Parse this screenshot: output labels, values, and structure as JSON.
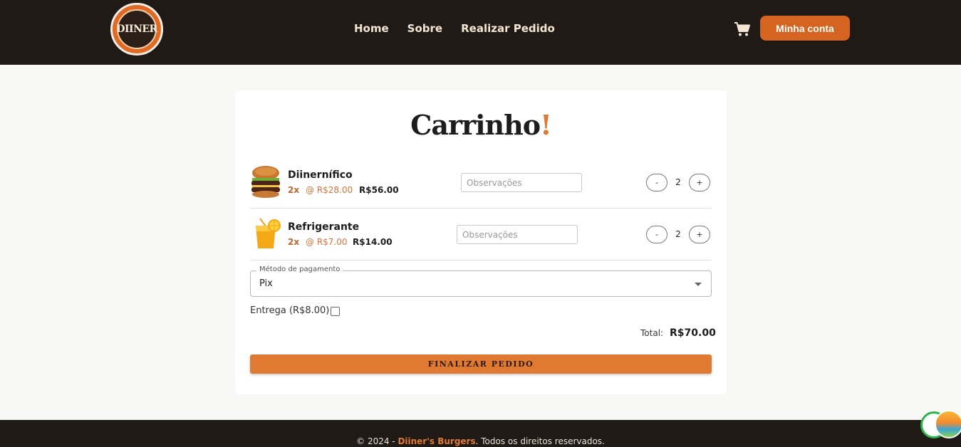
{
  "header": {
    "logo_text": "DIINER",
    "nav": [
      "Home",
      "Sobre",
      "Realizar Pedido"
    ],
    "account_button": "Minha conta"
  },
  "cart": {
    "title": "Carrinho",
    "title_accent": "!",
    "items": [
      {
        "name": "Diinernífico",
        "qty_label": "2x",
        "unit_price": "@ R$28.00",
        "line_total": "R$56.00",
        "obs_placeholder": "Observações",
        "minus": "-",
        "qty": "2",
        "plus": "+"
      },
      {
        "name": "Refrigerante",
        "qty_label": "2x",
        "unit_price": "@ R$7.00",
        "line_total": "R$14.00",
        "obs_placeholder": "Observações",
        "minus": "-",
        "qty": "2",
        "plus": "+"
      }
    ],
    "payment_label": "Método de pagamento",
    "payment_value": "Pix",
    "delivery_label": "Entrega (R$8.00)",
    "total_label": "Total:",
    "total_value": "R$70.00",
    "finish_button": "FINALIZAR PEDIDO"
  },
  "footer": {
    "prefix": "© 2024 - ",
    "brand": "Diiner's Burgers",
    "suffix": ". Todos os direitos reservados."
  },
  "colors": {
    "accent": "#e07a32",
    "header_bg": "#201a17"
  }
}
